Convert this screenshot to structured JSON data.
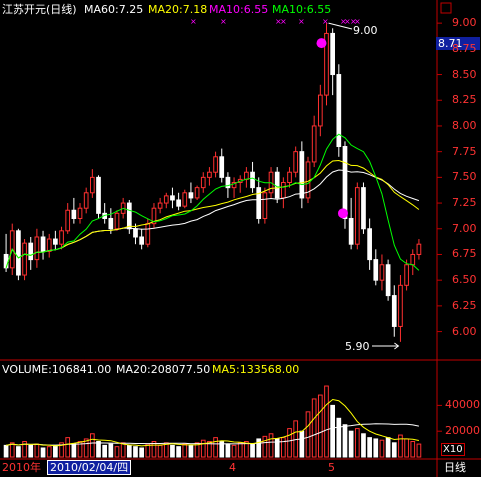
{
  "header": {
    "title": "江苏开元(日线)",
    "ma60": "MA60:7.25",
    "ma20": "MA20:7.18",
    "ma10_magenta": "MA10:6.55",
    "ma10_green": "MA10:6.55"
  },
  "current_price": "8.71",
  "high_label": "9.00",
  "low_label": "5.90",
  "volume_header": {
    "volume": "VOLUME:106841.00",
    "ma20": "MA20:208077.50",
    "ma5": "MA5:133568.00"
  },
  "volume_scale_label": "X10",
  "footer": {
    "year": "2010年",
    "cursor_date": "2010/02/04/四",
    "month_4": "4",
    "month_5": "5",
    "period": "日线"
  },
  "colors": {
    "up": "#ff3030",
    "down": "#ffffff",
    "ma60": "#ffffff",
    "ma20": "#ffff00",
    "ma10": "#00ff00",
    "marker": "#ff00ff",
    "axis": "#c00000"
  },
  "chart_data": [
    {
      "type": "candlestick",
      "title": "江苏开元(日线)",
      "price_ticks": [
        "9.00",
        "8.75",
        "8.50",
        "8.25",
        "8.00",
        "7.75",
        "7.50",
        "7.25",
        "7.00",
        "6.75",
        "6.50",
        "6.25",
        "6.00"
      ],
      "ylim": [
        5.85,
        9.05
      ],
      "ohlc": [
        [
          6.75,
          6.95,
          6.58,
          6.62
        ],
        [
          6.62,
          7.05,
          6.55,
          6.98
        ],
        [
          6.98,
          7.0,
          6.5,
          6.55
        ],
        [
          6.55,
          6.9,
          6.5,
          6.86
        ],
        [
          6.86,
          6.92,
          6.6,
          6.7
        ],
        [
          6.7,
          7.0,
          6.62,
          6.92
        ],
        [
          6.92,
          6.98,
          6.7,
          6.78
        ],
        [
          6.78,
          6.95,
          6.72,
          6.9
        ],
        [
          6.9,
          6.98,
          6.8,
          6.85
        ],
        [
          6.85,
          7.02,
          6.8,
          6.98
        ],
        [
          6.98,
          7.25,
          6.95,
          7.18
        ],
        [
          7.18,
          7.3,
          7.05,
          7.1
        ],
        [
          7.1,
          7.25,
          7.05,
          7.2
        ],
        [
          7.2,
          7.4,
          7.15,
          7.35
        ],
        [
          7.35,
          7.58,
          7.3,
          7.5
        ],
        [
          7.5,
          7.52,
          7.1,
          7.15
        ],
        [
          7.15,
          7.25,
          7.05,
          7.1
        ],
        [
          7.1,
          7.2,
          6.95,
          7.0
        ],
        [
          7.0,
          7.18,
          6.98,
          7.15
        ],
        [
          7.15,
          7.3,
          7.1,
          7.25
        ],
        [
          7.25,
          7.28,
          6.95,
          7.0
        ],
        [
          7.0,
          7.05,
          6.85,
          6.92
        ],
        [
          6.92,
          7.0,
          6.8,
          6.85
        ],
        [
          6.85,
          7.1,
          6.82,
          7.05
        ],
        [
          7.05,
          7.25,
          7.0,
          7.2
        ],
        [
          7.2,
          7.3,
          7.15,
          7.25
        ],
        [
          7.25,
          7.35,
          7.2,
          7.32
        ],
        [
          7.32,
          7.4,
          7.2,
          7.28
        ],
        [
          7.28,
          7.35,
          7.18,
          7.22
        ],
        [
          7.22,
          7.38,
          7.2,
          7.35
        ],
        [
          7.35,
          7.45,
          7.25,
          7.3
        ],
        [
          7.3,
          7.42,
          7.28,
          7.4
        ],
        [
          7.4,
          7.55,
          7.35,
          7.5
        ],
        [
          7.5,
          7.6,
          7.42,
          7.55
        ],
        [
          7.55,
          7.75,
          7.5,
          7.7
        ],
        [
          7.7,
          7.78,
          7.45,
          7.5
        ],
        [
          7.5,
          7.55,
          7.3,
          7.4
        ],
        [
          7.4,
          7.5,
          7.3,
          7.45
        ],
        [
          7.45,
          7.52,
          7.35,
          7.48
        ],
        [
          7.48,
          7.6,
          7.4,
          7.55
        ],
        [
          7.55,
          7.65,
          7.35,
          7.4
        ],
        [
          7.4,
          7.5,
          7.05,
          7.1
        ],
        [
          7.1,
          7.4,
          7.05,
          7.35
        ],
        [
          7.35,
          7.6,
          7.3,
          7.55
        ],
        [
          7.55,
          7.6,
          7.25,
          7.3
        ],
        [
          7.3,
          7.5,
          7.2,
          7.45
        ],
        [
          7.45,
          7.6,
          7.4,
          7.55
        ],
        [
          7.55,
          7.8,
          7.5,
          7.75
        ],
        [
          7.75,
          7.85,
          7.2,
          7.3
        ],
        [
          7.3,
          7.7,
          7.25,
          7.65
        ],
        [
          7.65,
          8.1,
          7.6,
          8.0
        ],
        [
          8.0,
          8.4,
          7.9,
          8.3
        ],
        [
          8.3,
          9.0,
          8.2,
          8.9
        ],
        [
          8.9,
          8.95,
          8.3,
          8.5
        ],
        [
          8.5,
          8.6,
          7.7,
          7.8
        ],
        [
          7.8,
          7.85,
          7.0,
          7.1
        ],
        [
          7.1,
          7.3,
          6.8,
          6.85
        ],
        [
          6.85,
          7.45,
          6.8,
          7.4
        ],
        [
          7.4,
          7.45,
          6.95,
          7.0
        ],
        [
          7.0,
          7.1,
          6.6,
          6.7
        ],
        [
          6.7,
          6.8,
          6.45,
          6.5
        ],
        [
          6.5,
          6.75,
          6.4,
          6.65
        ],
        [
          6.65,
          6.7,
          6.3,
          6.35
        ],
        [
          6.35,
          6.45,
          5.95,
          6.05
        ],
        [
          6.05,
          6.55,
          5.9,
          6.45
        ],
        [
          6.45,
          6.7,
          6.4,
          6.65
        ],
        [
          6.65,
          6.8,
          6.55,
          6.75
        ],
        [
          6.75,
          6.9,
          6.7,
          6.85
        ]
      ],
      "volume_ticks": [
        "40000",
        "20000"
      ],
      "volume_ylim": [
        0,
        62000
      ],
      "volume": [
        9000,
        11000,
        8000,
        12000,
        9000,
        10000,
        7000,
        8000,
        9000,
        11000,
        15000,
        10000,
        12000,
        14000,
        18000,
        12000,
        9000,
        10000,
        8000,
        11000,
        9000,
        8000,
        7000,
        10000,
        12000,
        9000,
        11000,
        9000,
        8000,
        10000,
        9000,
        11000,
        13000,
        12000,
        15000,
        12000,
        10000,
        9000,
        11000,
        12000,
        10000,
        14000,
        16000,
        18000,
        14000,
        15000,
        22000,
        28000,
        20000,
        35000,
        45000,
        48000,
        55000,
        40000,
        30000,
        25000,
        20000,
        22000,
        18000,
        15000,
        14000,
        13000,
        15000,
        11000,
        17000,
        14000,
        12000,
        10000
      ]
    }
  ]
}
